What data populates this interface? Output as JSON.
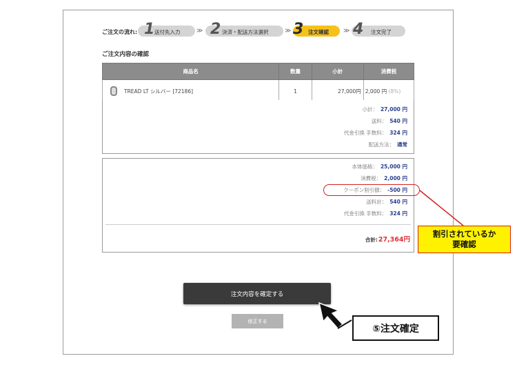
{
  "flow": {
    "label": "ご注文の流れ:",
    "steps": [
      {
        "num": "1",
        "label": "送付先入力"
      },
      {
        "num": "2",
        "label": "決済・配送方法選択"
      },
      {
        "num": "3",
        "label": "注文確認"
      },
      {
        "num": "4",
        "label": "注文完了"
      }
    ],
    "separator": "≫"
  },
  "section_title": "ご注文内容の確認",
  "table": {
    "headers": [
      "商品名",
      "数量",
      "小計",
      "消費税"
    ],
    "row": {
      "product": "TREAD LT シルバー [72186]",
      "qty": "1",
      "subtotal": "27,000円",
      "tax": "2,000 円",
      "tax_rate": "(8%)"
    }
  },
  "summary1": [
    {
      "label": "小計：",
      "value": "27,000 円"
    },
    {
      "label": "送料：",
      "value": "540 円"
    },
    {
      "label": "代金引換 手数料：",
      "value": "324 円"
    },
    {
      "label": "配送方法：",
      "value": "通常"
    }
  ],
  "summary2": [
    {
      "label": "本体価格：",
      "value": "25,000 円"
    },
    {
      "label": "消費税：",
      "value": "2,000 円"
    },
    {
      "label": "クーポン割引額：",
      "value": "-500 円"
    },
    {
      "label": "送料計：",
      "value": "540 円"
    },
    {
      "label": "代金引換 手数料：",
      "value": "324 円"
    }
  ],
  "total": {
    "label": "合計:",
    "value": "27,364円"
  },
  "callout_discount": {
    "line1": "割引されているか",
    "line2": "要確認"
  },
  "buttons": {
    "confirm": "注文内容を確定する",
    "modify": "修正する"
  },
  "callout_confirm": "⑤注文確定",
  "colors": {
    "active_step": "#f6c21a",
    "value_blue": "#2a3f8f",
    "total_red": "#e0303a",
    "callout_yellow": "#fff200",
    "annotation_red": "#d42020"
  }
}
